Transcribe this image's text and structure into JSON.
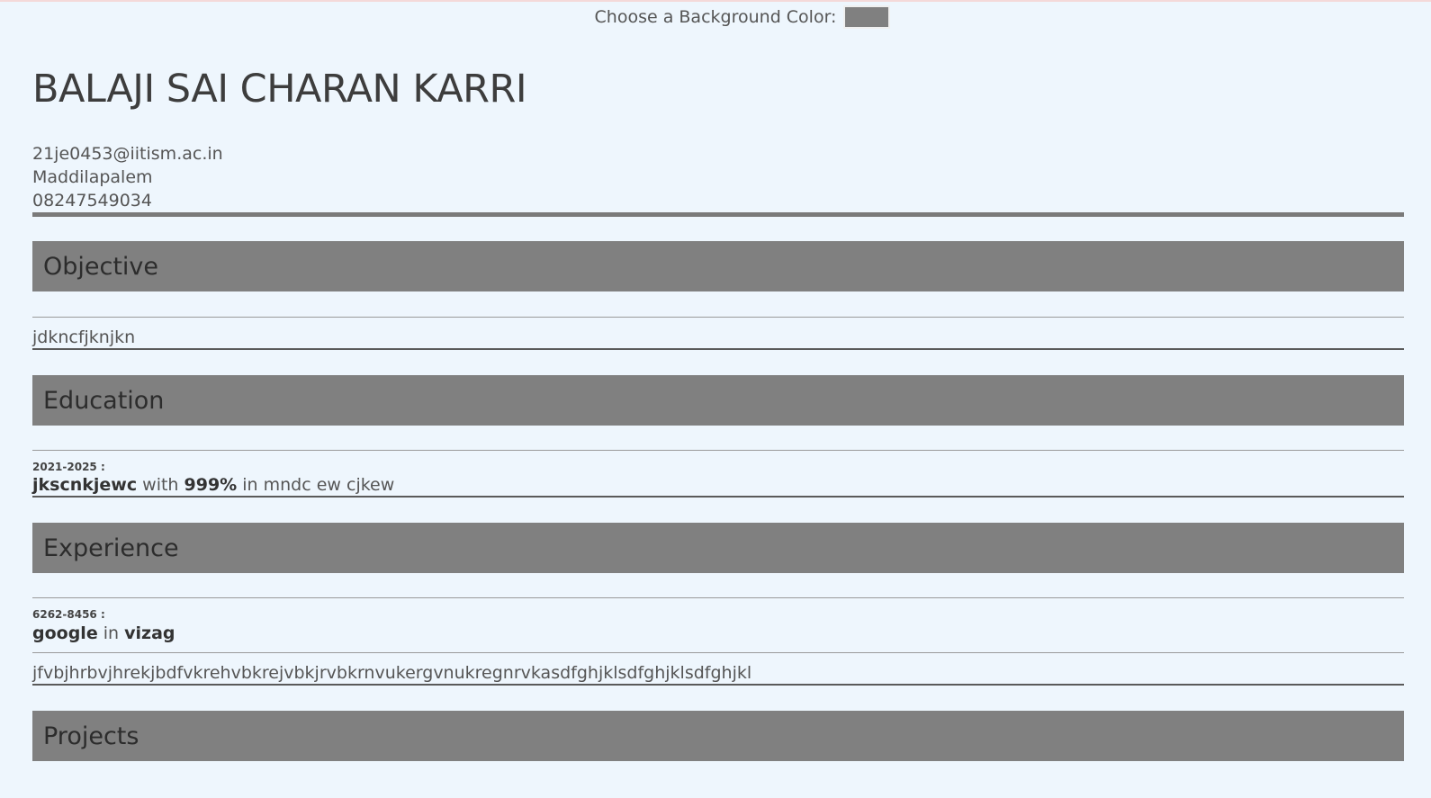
{
  "toolbar": {
    "bg_color_label": "Choose a Background Color:",
    "bg_color_value": "#808080"
  },
  "resume": {
    "name": "BALAJI SAI CHARAN KARRI",
    "contact": {
      "email": "21je0453@iitism.ac.in",
      "address": "Maddilapalem",
      "phone": "08247549034"
    },
    "sections": {
      "objective": {
        "title": "Objective",
        "text": "jdkncfjknjkn"
      },
      "education": {
        "title": "Education",
        "entries": [
          {
            "dates": "2021-2025 :",
            "institution": "jkscnkjewc",
            "with_word": "with",
            "score": "999%",
            "in_phrase": "in mndc ew cjkew"
          }
        ]
      },
      "experience": {
        "title": "Experience",
        "entries": [
          {
            "dates": "6262-8456 :",
            "company": "google",
            "in_word": "in",
            "location": "vizag",
            "description": "jfvbjhrbvjhrekjbdfvkrehvbkrejvbkjrvbkrnvukergvnukregnrvkasdfghjklsdfghjklsdfghjkl"
          }
        ]
      },
      "projects": {
        "title": "Projects"
      }
    }
  }
}
